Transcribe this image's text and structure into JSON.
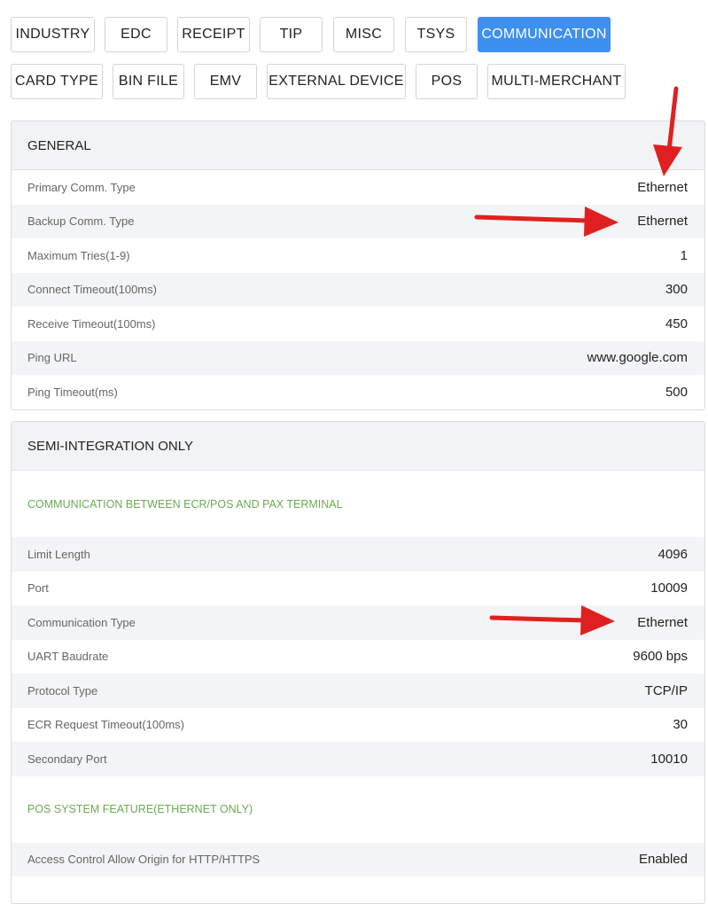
{
  "tabs": [
    {
      "label": "INDUSTRY",
      "active": false
    },
    {
      "label": "EDC",
      "active": false
    },
    {
      "label": "RECEIPT",
      "active": false
    },
    {
      "label": "TIP",
      "active": false
    },
    {
      "label": "MISC",
      "active": false
    },
    {
      "label": "TSYS",
      "active": false
    },
    {
      "label": "COMMUNICATION",
      "active": true
    },
    {
      "label": "CARD TYPE",
      "active": false
    },
    {
      "label": "BIN FILE",
      "active": false
    },
    {
      "label": "EMV",
      "active": false
    },
    {
      "label": "EXTERNAL DEVICE",
      "active": false
    },
    {
      "label": "POS",
      "active": false
    },
    {
      "label": "MULTI-MERCHANT",
      "active": false
    }
  ],
  "general": {
    "title": "GENERAL",
    "rows": [
      {
        "label": "Primary Comm. Type",
        "value": "Ethernet"
      },
      {
        "label": "Backup Comm. Type",
        "value": "Ethernet"
      },
      {
        "label": "Maximum Tries(1-9)",
        "value": "1"
      },
      {
        "label": "Connect Timeout(100ms)",
        "value": "300"
      },
      {
        "label": "Receive Timeout(100ms)",
        "value": "450"
      },
      {
        "label": "Ping URL",
        "value": "www.google.com"
      },
      {
        "label": "Ping Timeout(ms)",
        "value": "500"
      }
    ]
  },
  "semi": {
    "title": "SEMI-INTEGRATION ONLY",
    "section1": "COMMUNICATION BETWEEN ECR/POS AND PAX TERMINAL",
    "rows1": [
      {
        "label": "Limit Length",
        "value": "4096"
      },
      {
        "label": "Port",
        "value": "10009"
      },
      {
        "label": "Communication Type",
        "value": "Ethernet"
      },
      {
        "label": "UART Baudrate",
        "value": "9600 bps"
      },
      {
        "label": "Protocol Type",
        "value": "TCP/IP"
      },
      {
        "label": "ECR Request Timeout(100ms)",
        "value": "30"
      },
      {
        "label": "Secondary Port",
        "value": "10010"
      }
    ],
    "section2": "POS SYSTEM FEATURE(ETHERNET ONLY)",
    "rows2": [
      {
        "label": "Access Control Allow Origin for HTTP/HTTPS",
        "value": "Enabled"
      }
    ]
  },
  "colors": {
    "active_tab": "#3d8ff0",
    "section_title": "#6aaa53",
    "arrow": "#e02020"
  }
}
